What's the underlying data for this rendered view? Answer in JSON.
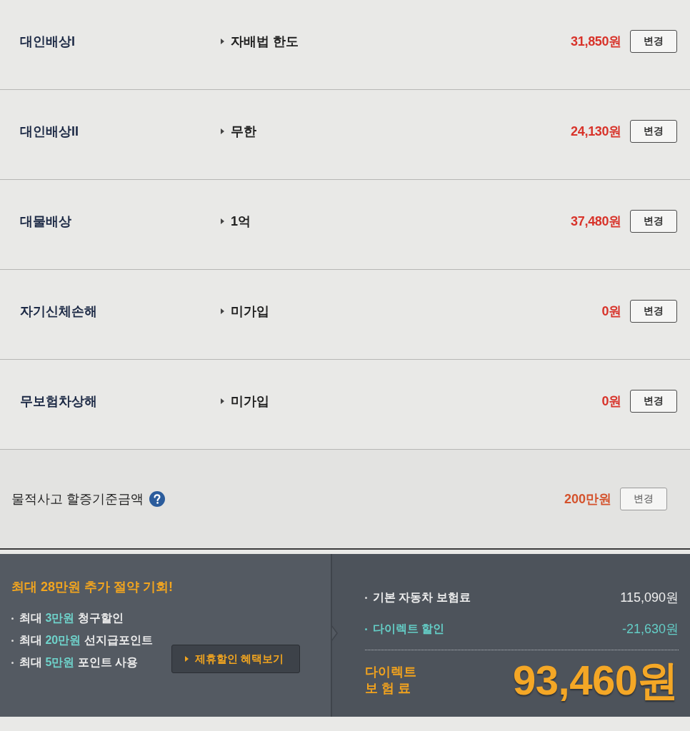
{
  "coverages": [
    {
      "label": "대인배상I",
      "option": "자배법 한도",
      "amount": "31,850원",
      "button": "변경"
    },
    {
      "label": "대인배상II",
      "option": "무한",
      "amount": "24,130원",
      "button": "변경"
    },
    {
      "label": "대물배상",
      "option": "1억",
      "amount": "37,480원",
      "button": "변경"
    },
    {
      "label": "자기신체손해",
      "option": "미가입",
      "amount": "0원",
      "button": "변경"
    },
    {
      "label": "무보험차상해",
      "option": "미가입",
      "amount": "0원",
      "button": "변경"
    }
  ],
  "surcharge": {
    "label": "물적사고 할증기준금액",
    "amount": "200만원",
    "button": "변경"
  },
  "promo": {
    "headline": "최대 28만원 추가 절약 기회!",
    "benefits": [
      {
        "prefix": "최대",
        "highlight": "3만원",
        "suffix": "청구할인"
      },
      {
        "prefix": "최대",
        "highlight": "20만원",
        "suffix": "선지급포인트"
      },
      {
        "prefix": "최대",
        "highlight": "5만원",
        "suffix": "포인트 사용"
      }
    ],
    "button": "제휴할인 혜택보기"
  },
  "summary": {
    "lines": [
      {
        "kind": "base",
        "label": "기본 자동차 보험료",
        "amount": "115,090원"
      },
      {
        "kind": "discount",
        "label": "다이렉트 할인",
        "amount": "-21,630원"
      }
    ],
    "total_label": [
      "다이렉트",
      "보 험 료"
    ],
    "total_amount": "93,460원"
  }
}
